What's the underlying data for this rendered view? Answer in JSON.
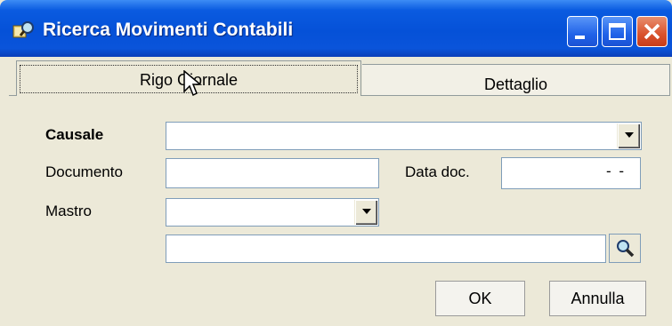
{
  "window": {
    "title": "Ricerca Movimenti Contabili",
    "title_icon": "search-book-icon"
  },
  "tabs": [
    {
      "label": "Rigo Giornale",
      "active": true
    },
    {
      "label": "Dettaglio",
      "active": false
    }
  ],
  "form": {
    "causale_label": "Causale",
    "causale_value": "",
    "documento_label": "Documento",
    "documento_value": "",
    "data_doc_label": "Data doc.",
    "data_doc_value": "- -",
    "mastro_label": "Mastro",
    "mastro_value": "",
    "conto_value": ""
  },
  "buttons": {
    "ok": "OK",
    "cancel": "Annulla"
  },
  "colors": {
    "titlebar": "#0551D8",
    "face": "#ECE9D8",
    "field_border": "#7F9DB9"
  }
}
